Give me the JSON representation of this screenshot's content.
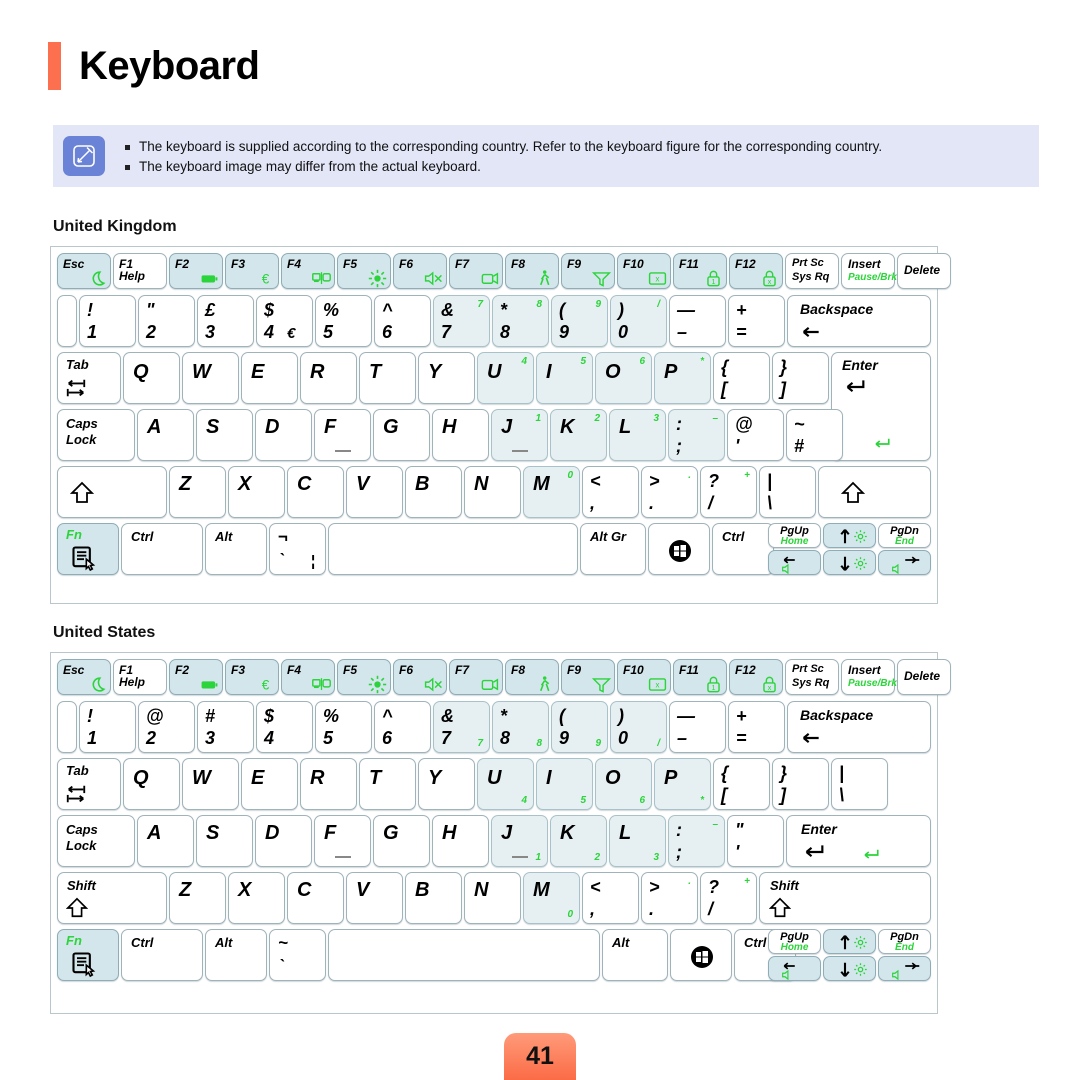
{
  "header": {
    "title": "Keyboard",
    "accent_color": "#fc7050"
  },
  "note": {
    "icon": "pencil-note-icon",
    "bullets": [
      "The keyboard is supplied according to the corresponding country. Refer to the keyboard figure for the corresponding country.",
      "The keyboard image may differ from the actual keyboard."
    ]
  },
  "sections": [
    {
      "id": "uk",
      "title": "United Kingdom"
    },
    {
      "id": "us",
      "title": "United States"
    }
  ],
  "footer": {
    "page_number": "41"
  },
  "colors": {
    "green_legend": "#2bd43a",
    "key_tint": "#d3e6ec",
    "note_bg": "#e2e6f7",
    "note_icon_bg": "#6b83d6"
  },
  "function_row": {
    "esc": "Esc",
    "f1": "F1",
    "f1_sub": "Help",
    "f2": "F2",
    "f3": "F3",
    "f4": "F4",
    "f5": "F5",
    "f6": "F6",
    "f7": "F7",
    "f8": "F8",
    "f9": "F9",
    "f10": "F10",
    "f11": "F11",
    "f12": "F12",
    "prtsc_1": "Prt Sc",
    "prtsc_2": "Sys Rq",
    "insert": "Insert",
    "insert_sub": "Pause/Brk",
    "delete": "Delete"
  },
  "common_keys": {
    "tab": "Tab",
    "caps_1": "Caps",
    "caps_2": "Lock",
    "shift": "Shift",
    "ctrl": "Ctrl",
    "alt": "Alt",
    "alt_gr": "Alt Gr",
    "fn": "Fn",
    "enter": "Enter",
    "backspace": "Backspace",
    "pgup": "PgUp",
    "home": "Home",
    "pgdn": "PgDn",
    "end": "End"
  },
  "uk_keyboard": {
    "number_row": [
      {
        "top": "!",
        "bottom": "1",
        "green": ""
      },
      {
        "top": "\"",
        "bottom": "2",
        "green": ""
      },
      {
        "top": "£",
        "bottom": "3",
        "green": ""
      },
      {
        "top": "$",
        "bottom": "4",
        "extra": "€",
        "green": ""
      },
      {
        "top": "%",
        "bottom": "5",
        "green": ""
      },
      {
        "top": "^",
        "bottom": "6",
        "green": ""
      },
      {
        "top": "&",
        "bottom": "7",
        "green": "7"
      },
      {
        "top": "*",
        "bottom": "8",
        "green": "8"
      },
      {
        "top": "(",
        "bottom": "9",
        "green": "9"
      },
      {
        "top": ")",
        "bottom": "0",
        "green": "/"
      },
      {
        "top": "—",
        "bottom": "–",
        "green": ""
      },
      {
        "top": "+",
        "bottom": "=",
        "green": ""
      }
    ],
    "q_row": [
      {
        "label": "Q",
        "green": ""
      },
      {
        "label": "W",
        "green": ""
      },
      {
        "label": "E",
        "green": ""
      },
      {
        "label": "R",
        "green": ""
      },
      {
        "label": "T",
        "green": ""
      },
      {
        "label": "Y",
        "green": ""
      },
      {
        "label": "U",
        "green": "4"
      },
      {
        "label": "I",
        "green": "5"
      },
      {
        "label": "O",
        "green": "6"
      },
      {
        "label": "P",
        "green": "*"
      }
    ],
    "q_row_punct": [
      {
        "top": "{",
        "bottom": "["
      },
      {
        "top": "}",
        "bottom": "]"
      }
    ],
    "a_row": [
      {
        "label": "A",
        "green": ""
      },
      {
        "label": "S",
        "green": ""
      },
      {
        "label": "D",
        "green": ""
      },
      {
        "label": "F",
        "green": ""
      },
      {
        "label": "G",
        "green": ""
      },
      {
        "label": "H",
        "green": ""
      },
      {
        "label": "J",
        "green": "1"
      },
      {
        "label": "K",
        "green": "2"
      },
      {
        "label": "L",
        "green": "3"
      }
    ],
    "a_row_punct": [
      {
        "top": ":",
        "bottom": ";",
        "green": "–"
      },
      {
        "top": "@",
        "bottom": "'"
      },
      {
        "top": "~",
        "bottom": "#"
      }
    ],
    "z_row": [
      {
        "label": "Z",
        "green": ""
      },
      {
        "label": "X",
        "green": ""
      },
      {
        "label": "C",
        "green": ""
      },
      {
        "label": "V",
        "green": ""
      },
      {
        "label": "B",
        "green": ""
      },
      {
        "label": "N",
        "green": ""
      },
      {
        "label": "M",
        "green": "0"
      }
    ],
    "z_row_punct": [
      {
        "top": "<",
        "bottom": ",",
        "green": ""
      },
      {
        "top": ">",
        "bottom": ".",
        "green": "."
      },
      {
        "top": "?",
        "bottom": "/",
        "green": "+"
      },
      {
        "top": "|",
        "bottom": "\\",
        "green": ""
      }
    ],
    "backslash_key": {
      "top": "¬",
      "bottom": "`",
      "extra": "¦"
    }
  },
  "us_keyboard": {
    "number_row": [
      {
        "top": "!",
        "bottom": "1",
        "green": ""
      },
      {
        "top": "@",
        "bottom": "2",
        "green": ""
      },
      {
        "top": "#",
        "bottom": "3",
        "green": ""
      },
      {
        "top": "$",
        "bottom": "4",
        "green": ""
      },
      {
        "top": "%",
        "bottom": "5",
        "green": ""
      },
      {
        "top": "^",
        "bottom": "6",
        "green": ""
      },
      {
        "top": "&",
        "bottom": "7",
        "green": "7"
      },
      {
        "top": "*",
        "bottom": "8",
        "green": "8"
      },
      {
        "top": "(",
        "bottom": "9",
        "green": "9"
      },
      {
        "top": ")",
        "bottom": "0",
        "green": "/"
      },
      {
        "top": "—",
        "bottom": "–",
        "green": ""
      },
      {
        "top": "+",
        "bottom": "=",
        "green": ""
      }
    ],
    "q_row": [
      {
        "label": "Q",
        "green": ""
      },
      {
        "label": "W",
        "green": ""
      },
      {
        "label": "E",
        "green": ""
      },
      {
        "label": "R",
        "green": ""
      },
      {
        "label": "T",
        "green": ""
      },
      {
        "label": "Y",
        "green": ""
      },
      {
        "label": "U",
        "green": "4"
      },
      {
        "label": "I",
        "green": "5"
      },
      {
        "label": "O",
        "green": "6"
      },
      {
        "label": "P",
        "green": "*"
      }
    ],
    "q_row_punct": [
      {
        "top": "{",
        "bottom": "["
      },
      {
        "top": "}",
        "bottom": "]"
      },
      {
        "top": "|",
        "bottom": "\\"
      }
    ],
    "a_row": [
      {
        "label": "A",
        "green": ""
      },
      {
        "label": "S",
        "green": ""
      },
      {
        "label": "D",
        "green": ""
      },
      {
        "label": "F",
        "green": ""
      },
      {
        "label": "G",
        "green": ""
      },
      {
        "label": "H",
        "green": ""
      },
      {
        "label": "J",
        "green": "1"
      },
      {
        "label": "K",
        "green": "2"
      },
      {
        "label": "L",
        "green": "3"
      }
    ],
    "a_row_punct": [
      {
        "top": ":",
        "bottom": ";",
        "green": "–"
      },
      {
        "top": "\"",
        "bottom": "'"
      }
    ],
    "z_row": [
      {
        "label": "Z",
        "green": ""
      },
      {
        "label": "X",
        "green": ""
      },
      {
        "label": "C",
        "green": ""
      },
      {
        "label": "V",
        "green": ""
      },
      {
        "label": "B",
        "green": ""
      },
      {
        "label": "N",
        "green": ""
      },
      {
        "label": "M",
        "green": "0"
      }
    ],
    "z_row_punct": [
      {
        "top": "<",
        "bottom": ",",
        "green": ""
      },
      {
        "top": ">",
        "bottom": ".",
        "green": "."
      },
      {
        "top": "?",
        "bottom": "/",
        "green": "+"
      }
    ],
    "tilde_key": {
      "top": "~",
      "bottom": "`"
    }
  }
}
